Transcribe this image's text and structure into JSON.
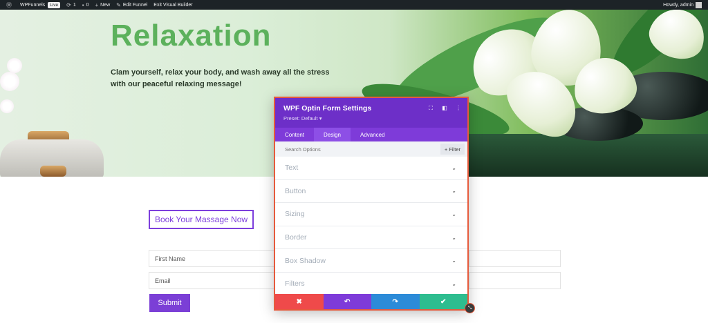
{
  "adminbar": {
    "site_name": "WPFunnels",
    "live_badge": "Live",
    "updates_count": "1",
    "comments_count": "0",
    "new_label": "New",
    "edit_funnel_label": "Edit Funnel",
    "exit_builder_label": "Exit Visual Builder",
    "howdy_label": "Howdy, admin"
  },
  "hero": {
    "title": "Relaxation",
    "text": "Clam yourself, relax your body, and wash away all the stress with our peaceful relaxing message!"
  },
  "cta": {
    "book_label": "Book Your Massage Now"
  },
  "form": {
    "first_name_placeholder": "First Name",
    "email_placeholder": "Email",
    "submit_label": "Submit"
  },
  "modal": {
    "title": "WPF Optin Form Settings",
    "preset": "Preset: Default ▾",
    "tabs": [
      {
        "label": "Content"
      },
      {
        "label": "Design"
      },
      {
        "label": "Advanced"
      }
    ],
    "active_tab": "Design",
    "search_placeholder": "Search Options",
    "filter_label": "+ Filter",
    "sections": [
      {
        "label": "Text"
      },
      {
        "label": "Button"
      },
      {
        "label": "Sizing"
      },
      {
        "label": "Border"
      },
      {
        "label": "Box Shadow"
      },
      {
        "label": "Filters"
      }
    ]
  },
  "colors": {
    "accent_purple": "#6d2fc8",
    "cancel_red": "#ef4a4a",
    "undo_purple": "#7e3bd9",
    "redo_blue": "#2c8bd8",
    "save_green": "#2ebd8f",
    "hero_title_green": "#5cb15c"
  }
}
